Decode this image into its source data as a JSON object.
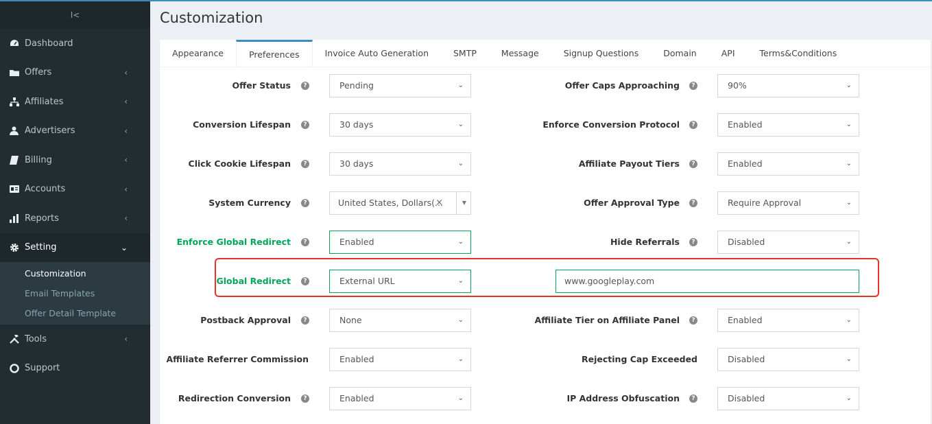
{
  "sidebar": {
    "collapse_glyph": "I<",
    "items": [
      {
        "label": "Dashboard",
        "icon": "dashboard-icon",
        "has_children": false
      },
      {
        "label": "Offers",
        "icon": "folder-icon",
        "has_children": true
      },
      {
        "label": "Affiliates",
        "icon": "sitemap-icon",
        "has_children": true
      },
      {
        "label": "Advertisers",
        "icon": "user-tie-icon",
        "has_children": true
      },
      {
        "label": "Billing",
        "icon": "book-icon",
        "has_children": true
      },
      {
        "label": "Accounts",
        "icon": "id-card-icon",
        "has_children": true
      },
      {
        "label": "Reports",
        "icon": "bar-chart-icon",
        "has_children": true
      },
      {
        "label": "Setting",
        "icon": "gear-icon",
        "has_children": true,
        "expanded": true
      },
      {
        "label": "Tools",
        "icon": "tools-icon",
        "has_children": true
      },
      {
        "label": "Support",
        "icon": "lifebuoy-icon",
        "has_children": false
      }
    ],
    "setting_submenu": [
      {
        "label": "Customization",
        "active": true
      },
      {
        "label": "Email Templates",
        "active": false
      },
      {
        "label": "Offer Detail Template",
        "active": false
      }
    ]
  },
  "page": {
    "title": "Customization"
  },
  "tabs": [
    "Appearance",
    "Preferences",
    "Invoice Auto Generation",
    "SMTP",
    "Message",
    "Signup Questions",
    "Domain",
    "API",
    "Terms&Conditions"
  ],
  "active_tab": "Preferences",
  "settings_left": [
    {
      "label": "Offer Status",
      "value": "Pending",
      "help": true
    },
    {
      "label": "Conversion Lifespan",
      "value": "30 days",
      "help": true
    },
    {
      "label": "Click Cookie Lifespan",
      "value": "30 days",
      "help": true
    },
    {
      "label": "System Currency",
      "value": "United States, Dollars(...",
      "help": true
    },
    {
      "label": "Enforce Global Redirect",
      "value": "Enabled",
      "help": true
    },
    {
      "label": "Global Redirect",
      "value": "External URL",
      "help": true
    },
    {
      "label": "Postback Approval",
      "value": "None",
      "help": true
    },
    {
      "label": "Affiliate Referrer Commission",
      "value": "Enabled",
      "help": false
    },
    {
      "label": "Redirection Conversion",
      "value": "Enabled",
      "help": true
    }
  ],
  "settings_right": [
    {
      "label": "Offer Caps Approaching",
      "value": "90%",
      "help": true
    },
    {
      "label": "Enforce Conversion Protocol",
      "value": "Enabled",
      "help": true
    },
    {
      "label": "Affiliate Payout Tiers",
      "value": "Enabled",
      "help": true
    },
    {
      "label": "Offer Approval Type",
      "value": "Require Approval",
      "help": true
    },
    {
      "label": "Hide Referrals",
      "value": "Disabled",
      "help": true
    },
    {
      "label": "Affiliate Tier on Affiliate Panel",
      "value": "Enabled",
      "help": true
    },
    {
      "label": "Rejecting Cap Exceeded",
      "value": "Disabled",
      "help": false
    },
    {
      "label": "IP Address Obfuscation",
      "value": "Disabled",
      "help": true
    }
  ],
  "global_redirect_url": "www.googleplay.com",
  "colors": {
    "sidebar_bg": "#222d32",
    "accent": "#3c8dbc",
    "success": "#00a65a",
    "highlight": "#e5332a"
  }
}
